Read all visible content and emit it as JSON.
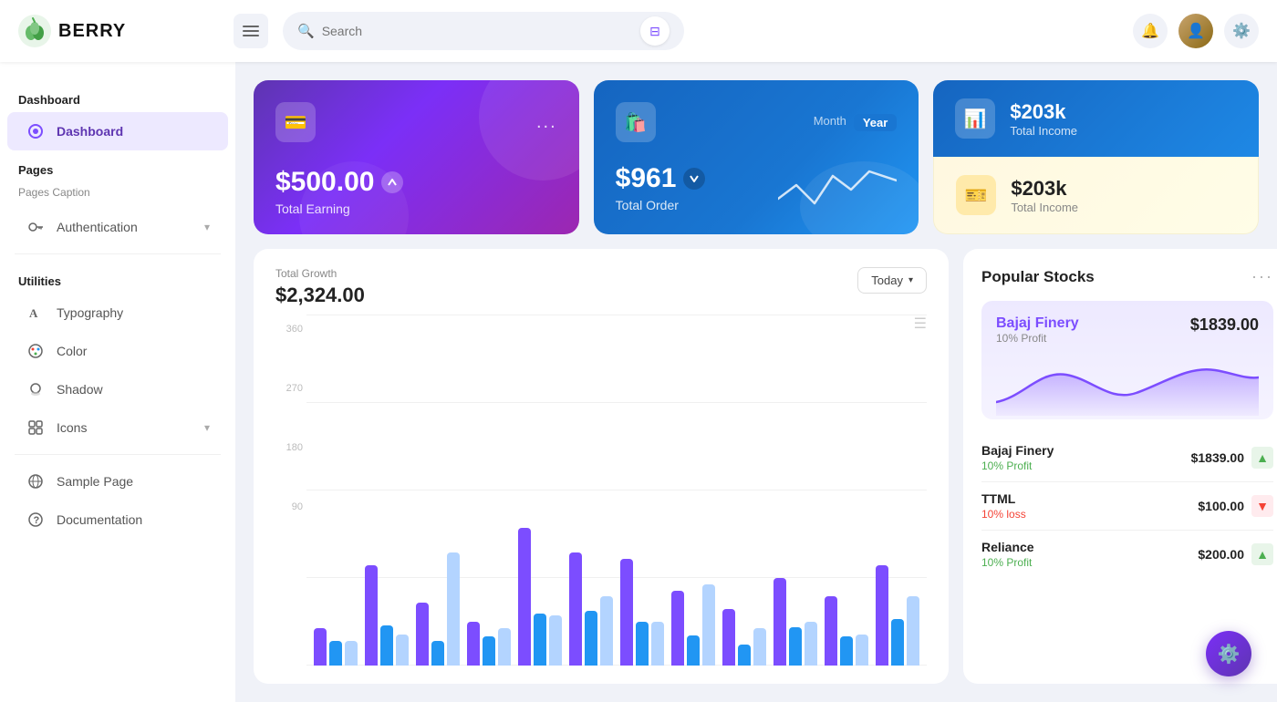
{
  "app": {
    "name": "BERRY",
    "logo_alt": "Berry logo"
  },
  "header": {
    "menu_label": "Menu",
    "search_placeholder": "Search",
    "notification_icon": "bell-icon",
    "settings_icon": "gear-icon",
    "avatar_icon": "user-avatar"
  },
  "sidebar": {
    "sections": [
      {
        "label": "Dashboard",
        "items": [
          {
            "id": "dashboard",
            "label": "Dashboard",
            "icon": "circle-icon",
            "active": true
          }
        ]
      },
      {
        "label": "Pages",
        "sublabel": "Pages Caption",
        "items": [
          {
            "id": "authentication",
            "label": "Authentication",
            "icon": "key-icon",
            "hasChevron": true
          }
        ]
      },
      {
        "label": "Utilities",
        "items": [
          {
            "id": "typography",
            "label": "Typography",
            "icon": "text-icon"
          },
          {
            "id": "color",
            "label": "Color",
            "icon": "palette-icon"
          },
          {
            "id": "shadow",
            "label": "Shadow",
            "icon": "shadow-icon"
          },
          {
            "id": "icons",
            "label": "Icons",
            "icon": "icons-icon",
            "hasChevron": true
          }
        ]
      },
      {
        "label": "",
        "items": [
          {
            "id": "sample-page",
            "label": "Sample Page",
            "icon": "globe-icon"
          },
          {
            "id": "documentation",
            "label": "Documentation",
            "icon": "help-icon"
          }
        ]
      }
    ]
  },
  "cards": {
    "earning": {
      "amount": "$500.00",
      "label": "Total Earning",
      "menu": "...",
      "icon": "wallet-icon"
    },
    "order": {
      "amount": "$961",
      "label": "Total Order",
      "toggle_month": "Month",
      "toggle_year": "Year",
      "icon": "shopping-icon"
    },
    "income_blue": {
      "amount": "$203k",
      "label": "Total Income",
      "icon": "grid-icon"
    },
    "income_yellow": {
      "amount": "$203k",
      "label": "Total Income",
      "icon": "ticket-icon"
    }
  },
  "growth_chart": {
    "title": "Total Growth",
    "amount": "$2,324.00",
    "filter_label": "Today",
    "y_labels": [
      "360",
      "270",
      "180",
      "90"
    ],
    "bars": [
      {
        "purple": 30,
        "blue": 15,
        "light": 20
      },
      {
        "purple": 80,
        "blue": 20,
        "light": 25
      },
      {
        "purple": 50,
        "blue": 12,
        "light": 90
      },
      {
        "purple": 35,
        "blue": 18,
        "light": 30
      },
      {
        "purple": 110,
        "blue": 25,
        "light": 40
      },
      {
        "purple": 90,
        "blue": 30,
        "light": 55
      },
      {
        "purple": 85,
        "blue": 22,
        "light": 35
      },
      {
        "purple": 60,
        "blue": 15,
        "light": 65
      },
      {
        "purple": 45,
        "blue": 10,
        "light": 30
      },
      {
        "purple": 70,
        "blue": 20,
        "light": 35
      },
      {
        "purple": 55,
        "blue": 15,
        "light": 25
      },
      {
        "purple": 80,
        "blue": 25,
        "light": 55
      }
    ]
  },
  "stocks": {
    "title": "Popular Stocks",
    "featured": {
      "name": "Bajaj Finery",
      "price": "$1839.00",
      "profit_label": "10% Profit"
    },
    "list": [
      {
        "name": "Bajaj Finery",
        "price": "$1839.00",
        "profit": "10% Profit",
        "trend": "up"
      },
      {
        "name": "TTML",
        "price": "$100.00",
        "profit": "10% loss",
        "trend": "down"
      },
      {
        "name": "Reliance",
        "price": "$200.00",
        "profit": "10% Profit",
        "trend": "up"
      }
    ]
  }
}
